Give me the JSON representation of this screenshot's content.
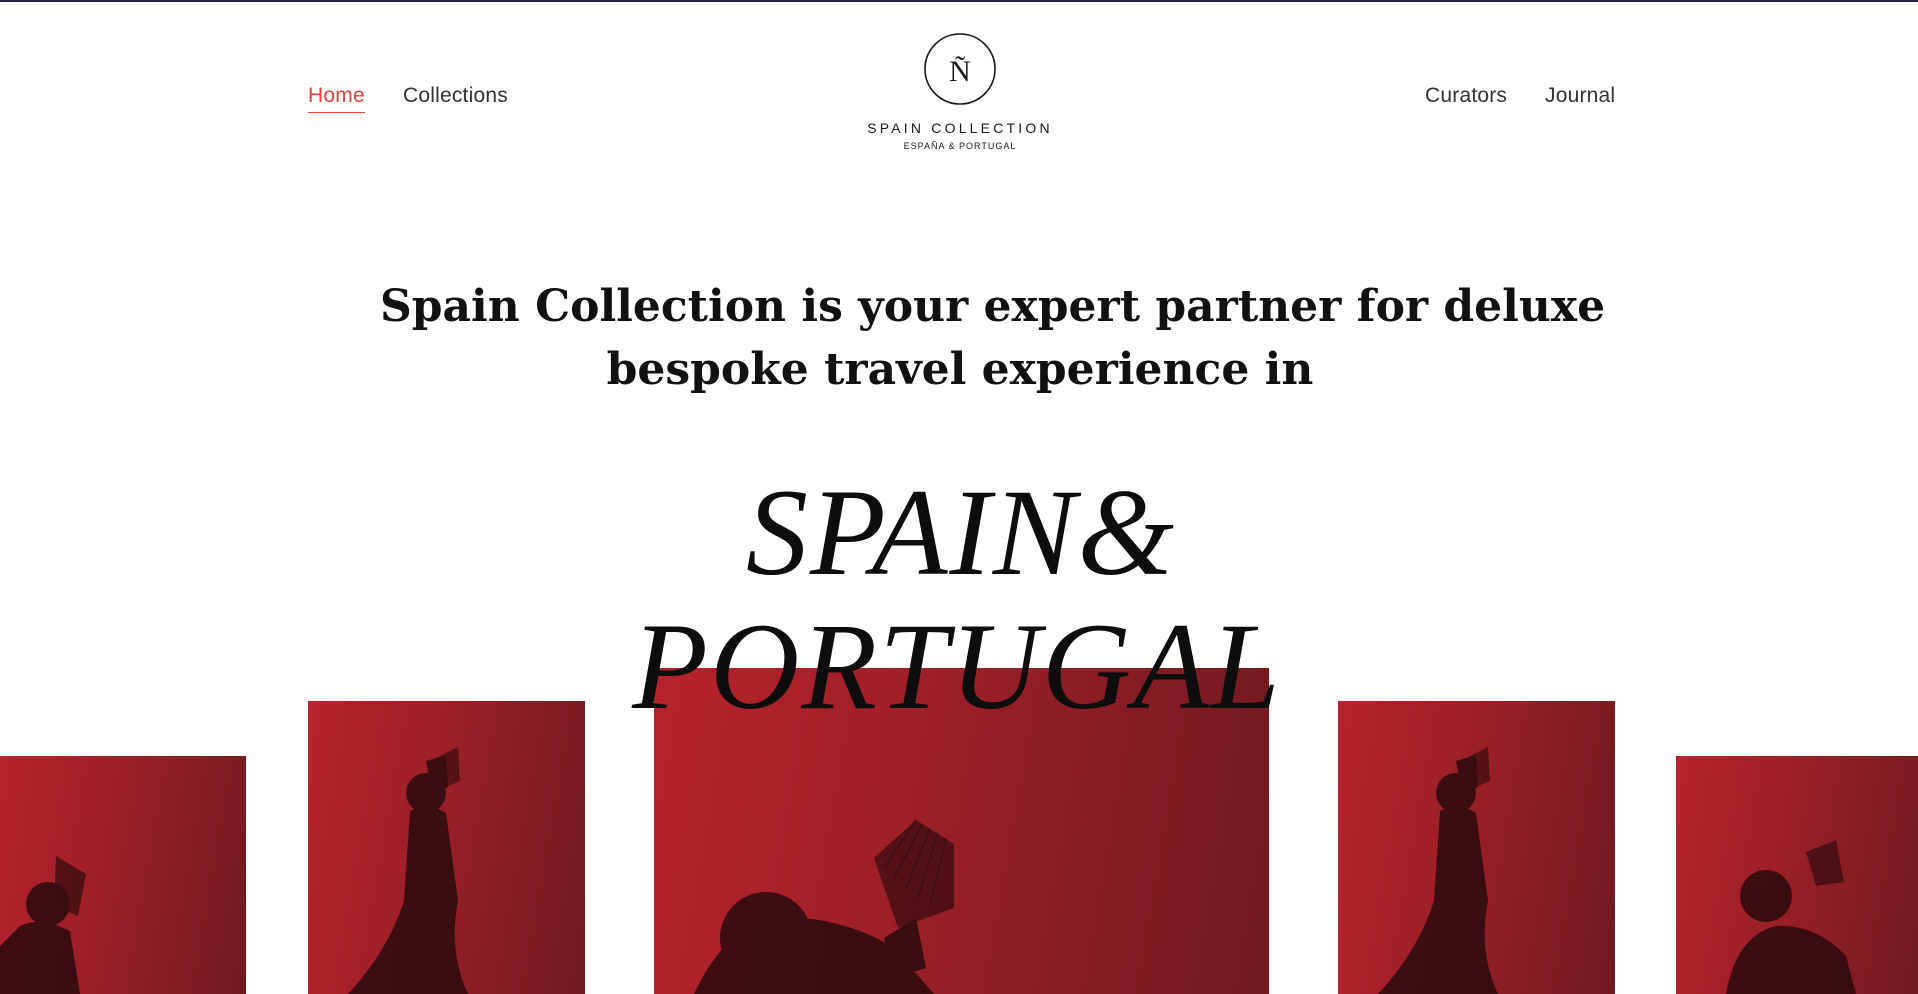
{
  "nav": {
    "left": [
      {
        "label": "Home",
        "active": true
      },
      {
        "label": "Collections",
        "active": false
      }
    ],
    "right": [
      {
        "label": "Curators",
        "active": false
      },
      {
        "label": "Journal",
        "active": false
      }
    ]
  },
  "logo": {
    "mark": "Ñ",
    "title": "SPAIN COLLECTION",
    "subtitle": "ESPAÑA & PORTUGAL"
  },
  "intro": {
    "line1": "Spain Collection is your expert partner for deluxe",
    "line2": "bespoke travel experience in"
  },
  "hero": {
    "line1": "SPAIN&",
    "line2": "PORTUGAL"
  },
  "gallery": {
    "images": [
      {
        "subject": "flamenco-dancer-with-fan",
        "position": "far-left"
      },
      {
        "subject": "flamenco-dancer-with-fan",
        "position": "left"
      },
      {
        "subject": "flamenco-dancer-with-fan",
        "position": "center"
      },
      {
        "subject": "flamenco-dancer-with-fan",
        "position": "right"
      },
      {
        "subject": "flamenco-dancer-with-fan",
        "position": "far-right"
      }
    ]
  },
  "colors": {
    "accent": "#e0423b",
    "image_red": "#b8232c",
    "image_dark": "#6f1a20",
    "text": "#111111",
    "top_rule": "#2a1f4a"
  }
}
